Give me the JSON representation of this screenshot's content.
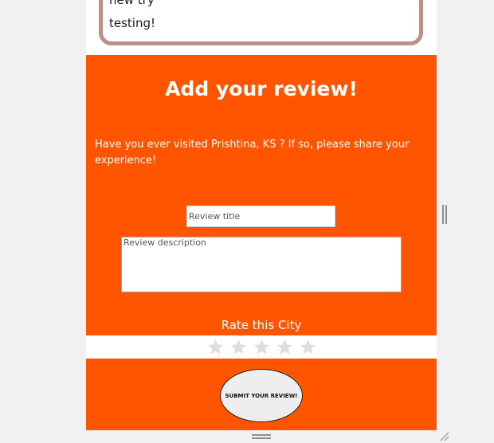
{
  "comments": {
    "lines": [
      "new try",
      "testing!"
    ]
  },
  "review": {
    "heading": "Add your review!",
    "prompt": "Have you ever visited Prishtina, KS ? If so, please share your experience!",
    "title_placeholder": "Review title",
    "description_placeholder": "Review description",
    "rate_label": "Rate this City",
    "rating": {
      "value": 0,
      "max": 5
    },
    "submit_label": "SUBMIT YOUR REVIEW!"
  },
  "colors": {
    "accent": "#ff5500",
    "comment_border": "#bc9184",
    "star_empty": "#dedede"
  },
  "icons": {
    "star": "star-icon",
    "resize_handle": "drag-handle-icon",
    "corner_grip": "resize-grip-icon"
  }
}
